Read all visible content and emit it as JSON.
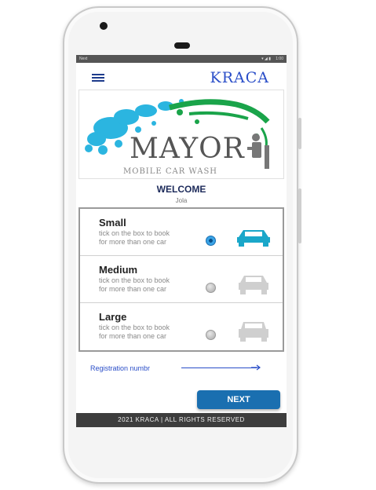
{
  "app": {
    "brand": "KRACA"
  },
  "statusbar": {
    "left_text": "Next",
    "right_text": "1:00"
  },
  "banner": {
    "title": "MAYOR",
    "subtitle": "MOBILE CAR WASH"
  },
  "greeting": {
    "title": "WELCOME",
    "user_name": "Jola"
  },
  "options": [
    {
      "title": "Small",
      "desc_line1": "tick on the box to book",
      "desc_line2": "for more than one car",
      "selected": true,
      "car_color": "#1aa7c9"
    },
    {
      "title": "Medium",
      "desc_line1": "tick on the box to book",
      "desc_line2": "for more than one car",
      "selected": false,
      "car_color": "#cfcfcf"
    },
    {
      "title": "Large",
      "desc_line1": "tick on the box to book",
      "desc_line2": "for more than one car",
      "selected": false,
      "car_color": "#cfcfcf"
    }
  ],
  "registration": {
    "label": "Registration numbr"
  },
  "actions": {
    "next_label": "NEXT"
  },
  "footer": {
    "text": "2021 KRACA | ALL RIGHTS RESERVED"
  },
  "colors": {
    "accent": "#1a6fb0",
    "brand": "#2a4ec8",
    "selected_car": "#1aa7c9",
    "footer_bg": "#3d3d3d"
  }
}
